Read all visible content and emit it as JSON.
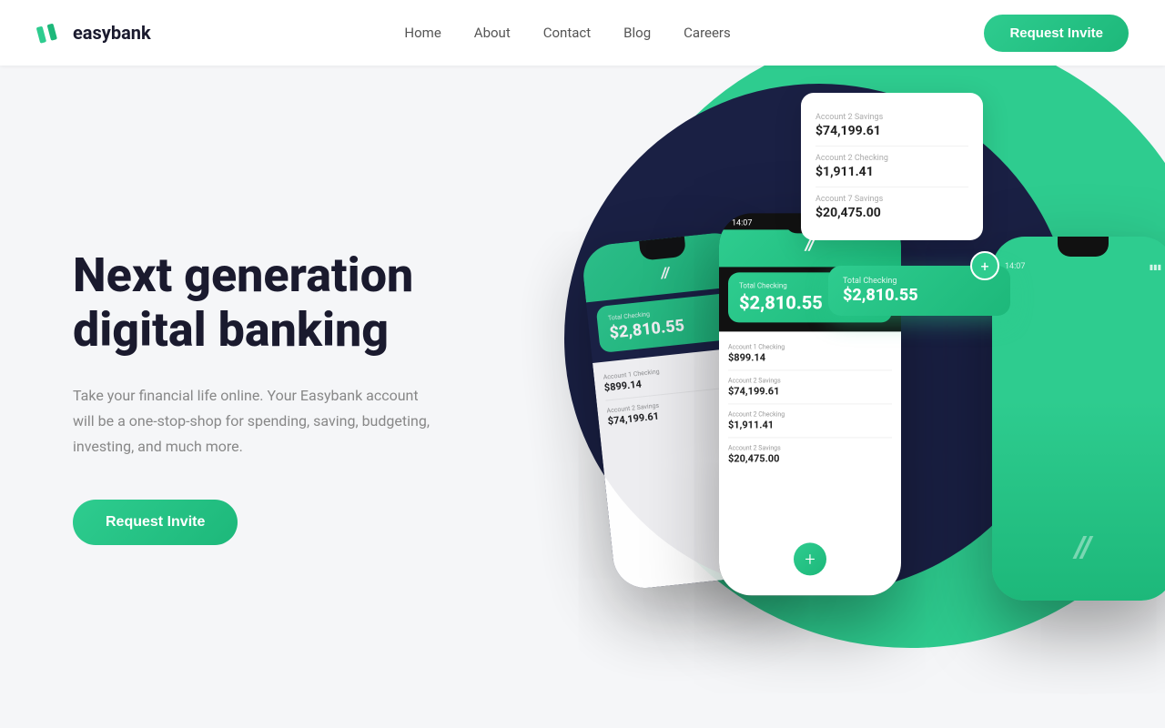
{
  "navbar": {
    "logo_text": "easybank",
    "links": [
      {
        "label": "Home",
        "id": "home"
      },
      {
        "label": "About",
        "id": "about"
      },
      {
        "label": "Contact",
        "id": "contact"
      },
      {
        "label": "Blog",
        "id": "blog"
      },
      {
        "label": "Careers",
        "id": "careers"
      }
    ],
    "cta_label": "Request Invite"
  },
  "hero": {
    "title_line1": "Next generation",
    "title_line2": "digital banking",
    "subtitle": "Take your financial life online. Your Easybank account will be a one-stop-shop for spending, saving, budgeting, investing, and much more.",
    "cta_label": "Request Invite"
  },
  "phone_main": {
    "time": "14:07",
    "header_icon": "//",
    "balance_label": "Total Checking",
    "balance_amount": "$2,810.55",
    "accounts": [
      {
        "name": "Account 1 Checking",
        "value": "$899.14"
      },
      {
        "name": "Account 2 Savings",
        "value": "$74,199.61"
      },
      {
        "name": "Account 2 Checking",
        "value": "$1,911.41"
      },
      {
        "name": "Account 2 Savings",
        "value": "$20,475.00"
      }
    ],
    "fab": "+"
  },
  "side_panel": {
    "items": [
      {
        "label": "Account 2 Savings",
        "value": "$74,199.61"
      },
      {
        "label": "Account 2 Checking",
        "value": "$1,911.41"
      },
      {
        "label": "Account 7 Savings",
        "value": "$20,475.00"
      }
    ]
  },
  "side_balance": {
    "label": "Total Checking",
    "amount": "$2,810.55",
    "fab": "+"
  },
  "phone_back_right": {
    "time": "14:07",
    "logo_icon": "//",
    "balance_label": "Total Checking",
    "balance_amount": "$2,810.55"
  },
  "colors": {
    "green": "#2ecc8f",
    "dark_navy": "#1a2044",
    "white": "#ffffff"
  }
}
